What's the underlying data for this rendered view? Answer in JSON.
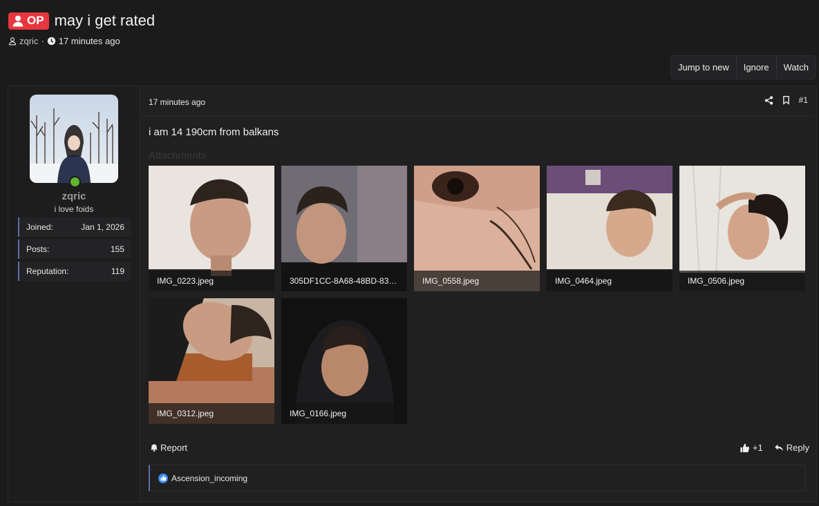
{
  "thread": {
    "badge": "OP",
    "title": "may i get rated",
    "author": "zqric",
    "time": "17 minutes ago"
  },
  "toolbar": {
    "jump": "Jump to new",
    "ignore": "Ignore",
    "watch": "Watch"
  },
  "user": {
    "name": "zqric",
    "title": "i love foids",
    "stats": [
      {
        "label": "Joined:",
        "value": "Jan 1, 2026"
      },
      {
        "label": "Posts:",
        "value": "155"
      },
      {
        "label": "Reputation:",
        "value": "119"
      }
    ]
  },
  "post": {
    "time": "17 minutes ago",
    "number": "#1",
    "text": "i am 14 190cm from balkans",
    "attachments_label": "Attachments",
    "attachments": [
      "IMG_0223.jpeg",
      "305DF1CC-8A68-48BD-839...",
      "IMG_0558.jpeg",
      "IMG_0464.jpeg",
      "IMG_0506.jpeg",
      "IMG_0312.jpeg",
      "IMG_0166.jpeg"
    ],
    "report": "Report",
    "likes": "+1",
    "reply": "Reply",
    "reaction_user": "Ascension_incoming"
  },
  "colors": {
    "accent": "#e8373f",
    "online": "#5eb52f",
    "border_accent": "#5c6ea8",
    "like": "#3b8ded"
  }
}
